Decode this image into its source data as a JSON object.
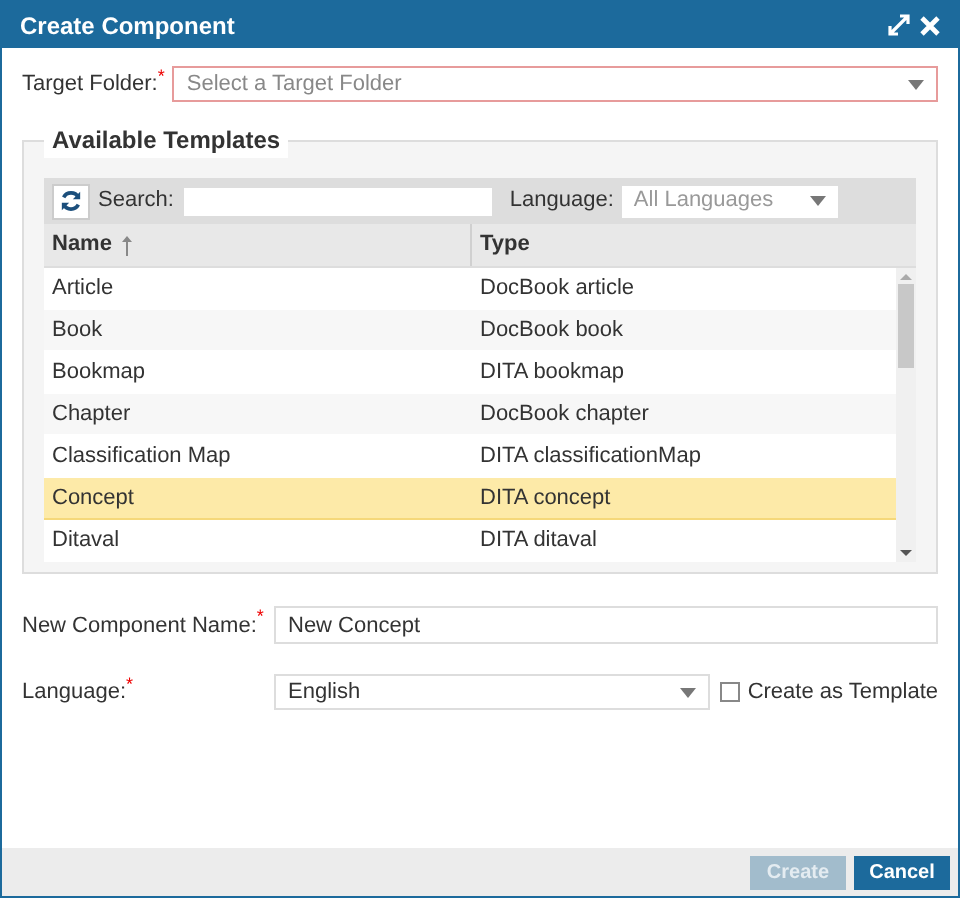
{
  "window": {
    "title": "Create Component"
  },
  "target_folder": {
    "label": "Target Folder:",
    "required_mark": "*",
    "placeholder": "Select a Target Folder"
  },
  "templates": {
    "legend": "Available Templates",
    "search": {
      "label": "Search:"
    },
    "language_filter": {
      "label": "Language:",
      "value": "All Languages"
    },
    "columns": [
      {
        "label": "Name",
        "sorted": true
      },
      {
        "label": "Type",
        "sorted": false
      }
    ],
    "rows": [
      {
        "name": "Article",
        "type": "DocBook article",
        "selected": false
      },
      {
        "name": "Book",
        "type": "DocBook book",
        "selected": false
      },
      {
        "name": "Bookmap",
        "type": "DITA bookmap",
        "selected": false
      },
      {
        "name": "Chapter",
        "type": "DocBook chapter",
        "selected": false
      },
      {
        "name": "Classification Map",
        "type": "DITA classificationMap",
        "selected": false
      },
      {
        "name": "Concept",
        "type": "DITA concept",
        "selected": true
      },
      {
        "name": "Ditaval",
        "type": "DITA ditaval",
        "selected": false
      }
    ]
  },
  "component_name": {
    "label": "New Component Name:",
    "required_mark": "*",
    "value": "New Concept"
  },
  "language": {
    "label": "Language:",
    "required_mark": "*",
    "value": "English"
  },
  "create_as_template": {
    "label": "Create as Template",
    "checked": false
  },
  "buttons": [
    {
      "label": "Create",
      "disabled": true
    },
    {
      "label": "Cancel",
      "disabled": false
    }
  ]
}
